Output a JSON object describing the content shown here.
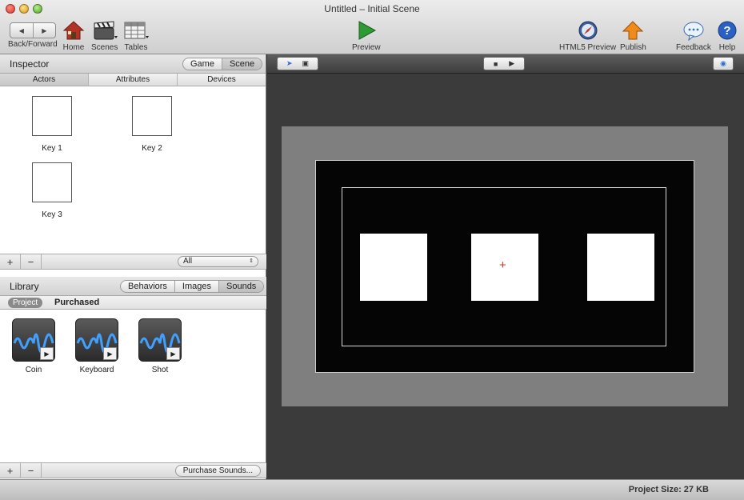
{
  "window": {
    "title": "Untitled – Initial Scene"
  },
  "toolbar": {
    "back_forward": "Back/Forward",
    "home": "Home",
    "scenes": "Scenes",
    "tables": "Tables",
    "preview": "Preview",
    "html5_preview": "HTML5 Preview",
    "publish": "Publish",
    "feedback": "Feedback",
    "help": "Help"
  },
  "inspector": {
    "title": "Inspector",
    "modes": [
      "Game",
      "Scene"
    ],
    "active_mode": "Scene",
    "tabs": [
      "Actors",
      "Attributes",
      "Devices"
    ],
    "actors": [
      {
        "name": "Key 1"
      },
      {
        "name": "Key 2"
      },
      {
        "name": "Key 3"
      }
    ],
    "filter": "All"
  },
  "library": {
    "title": "Library",
    "tabs": [
      "Behaviors",
      "Images",
      "Sounds"
    ],
    "active_tab": "Sounds",
    "subtabs": [
      "Project",
      "Purchased"
    ],
    "sounds": [
      {
        "name": "Coin"
      },
      {
        "name": "Keyboard"
      },
      {
        "name": "Shot"
      }
    ],
    "purchase_button": "Purchase Sounds..."
  },
  "status": {
    "project_size": "Project Size: 27 KB"
  },
  "colors": {
    "accent_green": "#2e9a33",
    "publish_orange": "#f08a1a",
    "help_blue": "#2a5fc4"
  }
}
